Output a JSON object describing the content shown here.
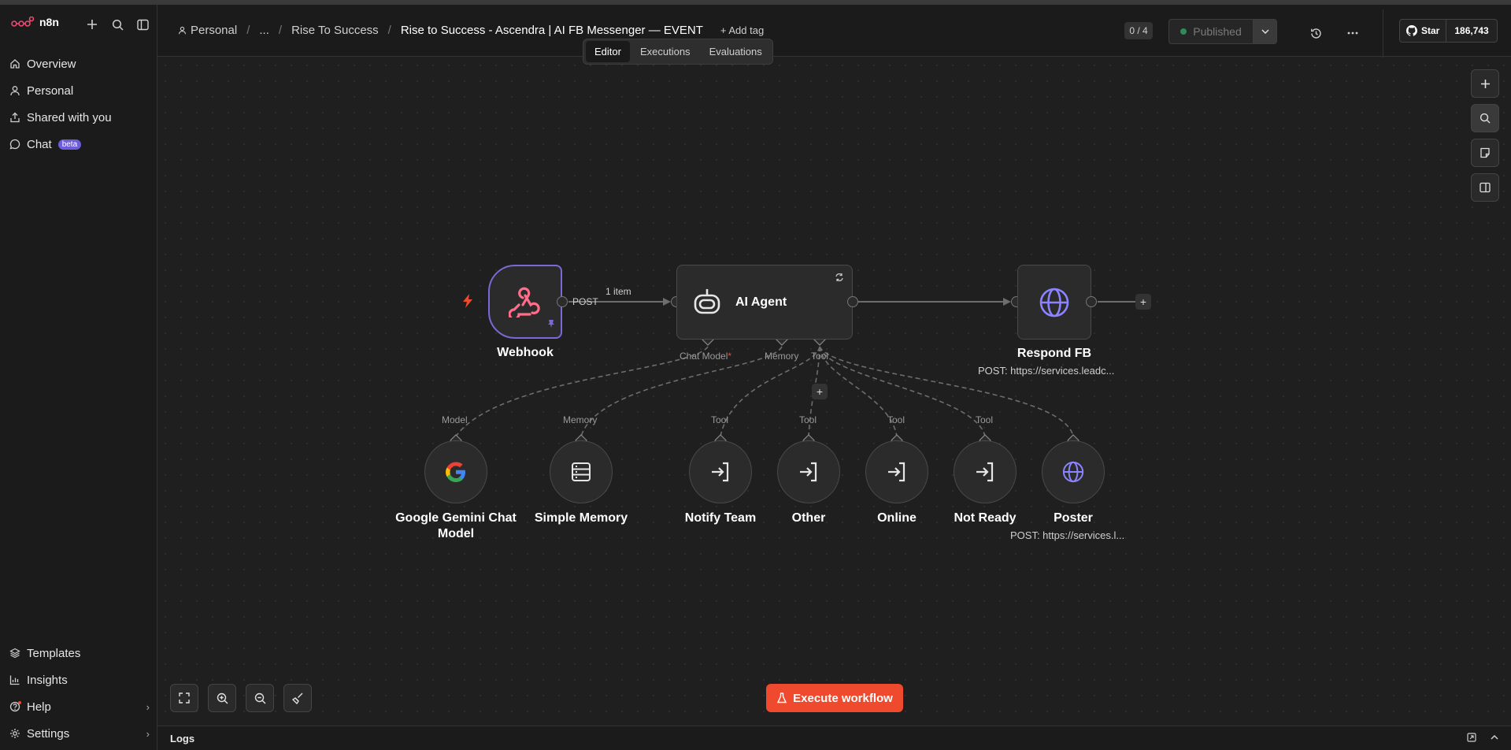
{
  "app": {
    "name": "n8n"
  },
  "sidebar": {
    "items": [
      {
        "label": "Overview",
        "icon": "home-icon"
      },
      {
        "label": "Personal",
        "icon": "user-icon"
      },
      {
        "label": "Shared with you",
        "icon": "share-icon"
      },
      {
        "label": "Chat",
        "icon": "chat-icon",
        "badge": "beta"
      }
    ],
    "bottom": [
      {
        "label": "Templates",
        "icon": "templates-icon"
      },
      {
        "label": "Insights",
        "icon": "chart-icon"
      },
      {
        "label": "Help",
        "icon": "help-icon"
      },
      {
        "label": "Settings",
        "icon": "gear-icon"
      }
    ]
  },
  "header": {
    "breadcrumb": [
      "Personal",
      "...",
      "Rise To Success"
    ],
    "title": "Rise to Success - Ascendra | AI FB Messenger — EVENT",
    "add_tag": "+ Add tag",
    "tabs": [
      "Editor",
      "Executions",
      "Evaluations"
    ],
    "counter": "0 / 4",
    "publish_label": "Published",
    "github_star": "Star",
    "github_count": "186,743"
  },
  "canvas": {
    "webhook": {
      "label": "Webhook",
      "method": "POST",
      "items": "1 item"
    },
    "agent": {
      "label": "AI Agent",
      "inputs": [
        "Chat Model",
        "Memory",
        "Tool"
      ],
      "required_mark": "*"
    },
    "respond": {
      "label": "Respond FB",
      "sub": "POST: https://services.leadc..."
    },
    "subnodes": [
      {
        "label": "Google Gemini Chat Model",
        "conn": "Model"
      },
      {
        "label": "Simple Memory",
        "conn": "Memory"
      },
      {
        "label": "Notify Team",
        "conn": "Tool"
      },
      {
        "label": "Other",
        "conn": "Tool"
      },
      {
        "label": "Online",
        "conn": "Tool"
      },
      {
        "label": "Not Ready",
        "conn": "Tool"
      },
      {
        "label": "Poster",
        "conn": "",
        "sub": "POST: https://services.l..."
      }
    ]
  },
  "footer": {
    "execute": "Execute workflow",
    "logs": "Logs"
  },
  "colors": {
    "accent": "#7b6ad6",
    "execute": "#ef4a2d",
    "webhook": "#ff6d8a",
    "globe": "#8b83ff"
  }
}
